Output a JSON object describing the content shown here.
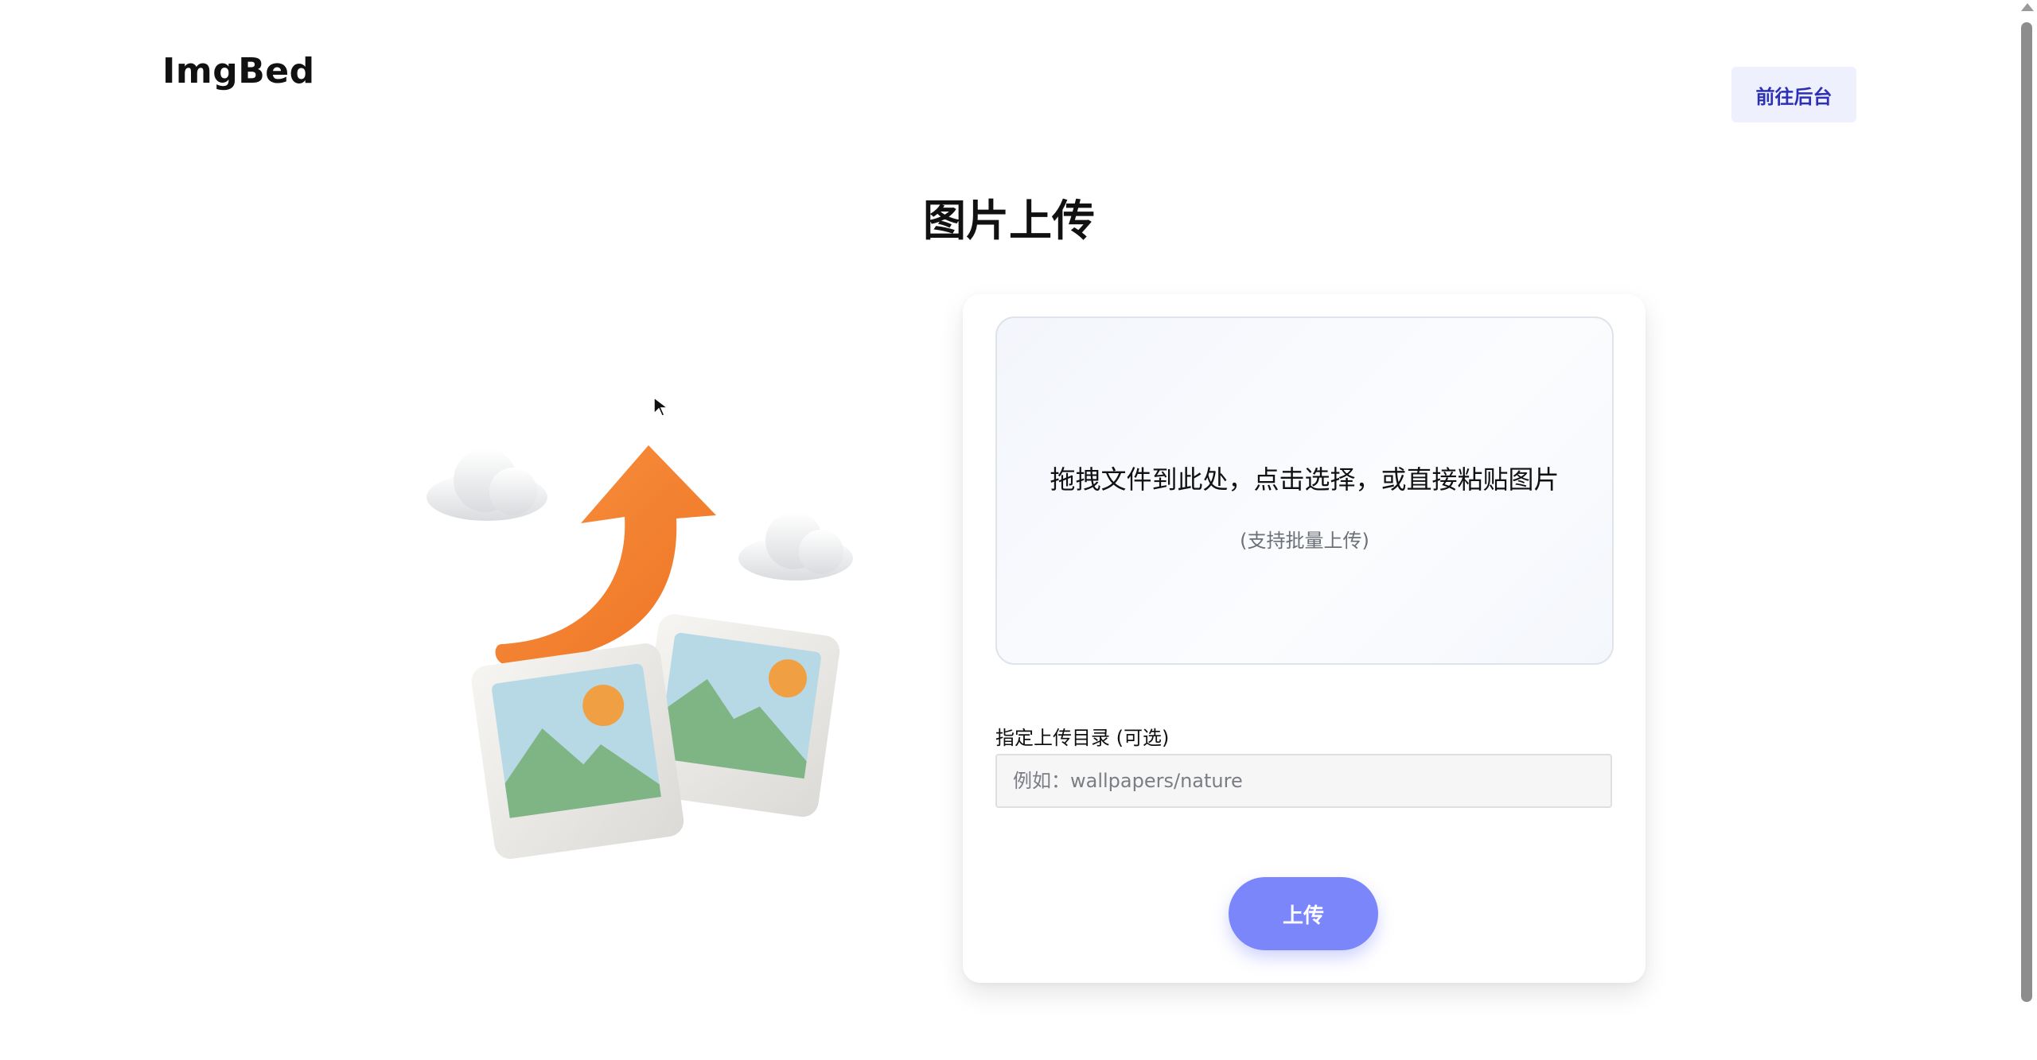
{
  "header": {
    "logo": "ImgBed",
    "admin_button": "前往后台"
  },
  "main": {
    "title": "图片上传"
  },
  "upload_card": {
    "dropzone_text": "拖拽文件到此处，点击选择，或直接粘贴图片",
    "dropzone_hint": "(支持批量上传)",
    "directory_label": "指定上传目录 (可选)",
    "directory_placeholder": "例如：wallpapers/nature",
    "directory_value": "",
    "upload_button": "上传"
  },
  "colors": {
    "accent_button": "#7b86fb",
    "admin_button_bg": "#eef0fd",
    "admin_button_text": "#2d2fb5",
    "arrow": "#f3802f"
  },
  "icons": {
    "illustration": "upload-photos-illustration",
    "cursor": "mouse-pointer-icon"
  }
}
